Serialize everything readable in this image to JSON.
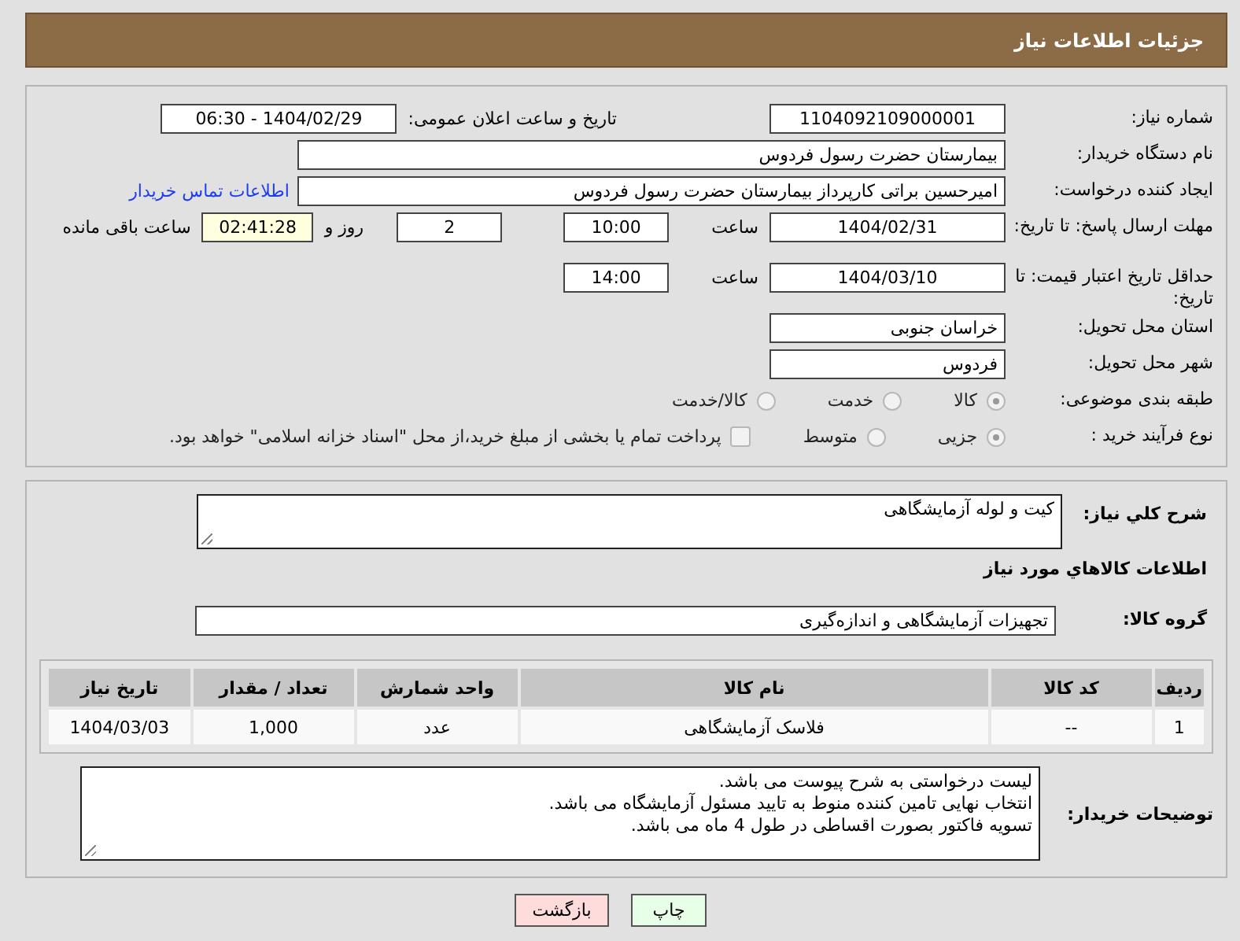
{
  "title": "جزئیات اطلاعات نیاز",
  "rows": [
    {
      "label": "شماره نیاز:",
      "items": [
        {
          "kind": "field",
          "value": "1104092109000001"
        },
        {
          "kind": "text",
          "text": "تاریخ و ساعت اعلان عمومی:"
        },
        {
          "kind": "ltr_field",
          "value": "1404/02/29 - 06:30"
        }
      ]
    },
    {
      "label": "نام دستگاه خریدار:",
      "items": [
        {
          "kind": "wide_field",
          "value": "بیمارستان حضرت رسول فردوس"
        }
      ]
    },
    {
      "label": "ایجاد کننده درخواست:",
      "items": [
        {
          "kind": "wide_field",
          "value": "امیرحسین براتی کارپرداز بیمارستان حضرت رسول فردوس"
        },
        {
          "kind": "link",
          "text": "اطلاعات تماس خریدار"
        }
      ]
    },
    {
      "label": "مهلت ارسال پاسخ: تا تاریخ:",
      "items": [
        {
          "kind": "field",
          "value": "1404/02/31"
        },
        {
          "kind": "text",
          "text": "ساعت"
        },
        {
          "kind": "time_field",
          "value": "10:00"
        },
        {
          "kind": "time_field",
          "value": "2"
        },
        {
          "kind": "text",
          "text": "روز و"
        },
        {
          "kind": "timer",
          "value": "02:41:28"
        },
        {
          "kind": "text",
          "text": "ساعت باقی مانده"
        }
      ]
    },
    {
      "label": "حداقل تاریخ اعتبار قیمت: تا تاریخ:",
      "items": [
        {
          "kind": "field",
          "value": "1404/03/10"
        },
        {
          "kind": "text",
          "text": "ساعت"
        },
        {
          "kind": "time_field",
          "value": "14:00"
        }
      ]
    },
    {
      "label": "استان محل تحویل:",
      "items": [
        {
          "kind": "text_field",
          "value": "خراسان جنوبی"
        }
      ]
    },
    {
      "label": "شهر محل تحویل:",
      "items": [
        {
          "kind": "text_field",
          "value": "فردوس"
        }
      ]
    },
    {
      "label": "طبقه بندی موضوعی:",
      "items": [
        {
          "kind": "radio",
          "text": "کالا",
          "selected": true
        },
        {
          "kind": "radio",
          "text": "خدمت",
          "selected": false
        },
        {
          "kind": "radio",
          "text": "کالا/خدمت",
          "selected": false
        }
      ]
    },
    {
      "label": "نوع فرآیند خرید :",
      "items": [
        {
          "kind": "radio",
          "text": "جزیی",
          "selected": true
        },
        {
          "kind": "radio",
          "text": "متوسط",
          "selected": false
        },
        {
          "kind": "checkbox",
          "text": "پرداخت تمام یا بخشی از مبلغ خرید،از محل \"اسناد خزانه اسلامی\" خواهد بود.",
          "checked": false
        }
      ]
    }
  ],
  "description": {
    "label": "شرح كلي نياز:",
    "value": "کیت و لوله آزمایشگاهی"
  },
  "goods_title": "اطلاعات كالاهاي مورد نياز",
  "goods_group": {
    "label": "گروه کالا:",
    "value": "تجهیزات آزمایشگاهی و اندازه‌گیری"
  },
  "table": {
    "columns": [
      "ردیف",
      "کد کالا",
      "نام کالا",
      "واحد شمارش",
      "تعداد / مقدار",
      "تاریخ نیاز"
    ],
    "rows": [
      [
        "1",
        "--",
        "فلاسک آزمایشگاهی",
        "عدد",
        "1,000",
        "1404/03/03"
      ]
    ]
  },
  "buyer_notes": {
    "label": "توضیحات خریدار:",
    "lines": [
      "لیست درخواستی به شرح پیوست می باشد.",
      "انتخاب نهایی تامین کننده منوط به تایید مسئول آزمایشگاه می باشد.",
      "تسویه فاکتور بصورت اقساطی در طول 4 ماه می باشد."
    ]
  },
  "buttons": [
    {
      "kind": "print",
      "label": "چاپ"
    },
    {
      "kind": "back",
      "label": "بازگشت"
    }
  ]
}
